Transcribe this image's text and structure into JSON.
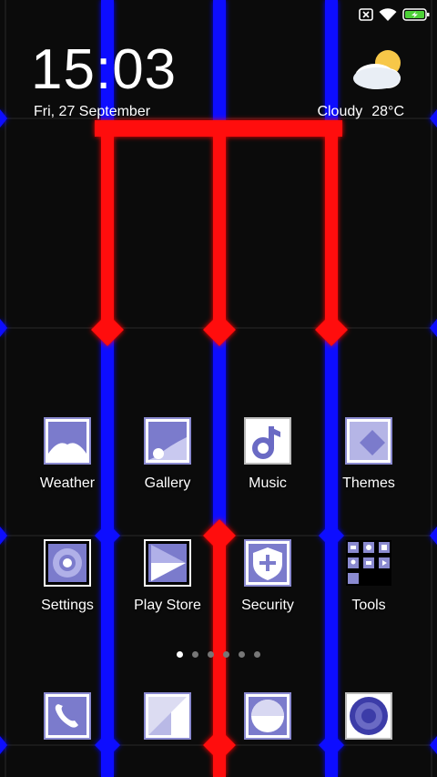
{
  "status_bar": {
    "icons": [
      "sim-off-icon",
      "wifi-icon",
      "battery-charging-icon"
    ],
    "battery_color": "#4cd137"
  },
  "clock": {
    "time": "15:03",
    "date": "Fri, 27 September"
  },
  "weather": {
    "condition": "Cloudy",
    "temperature": "28°C",
    "icon": "cloud-sun-icon"
  },
  "apps": [
    {
      "label": "Weather",
      "icon": "weather-app-icon"
    },
    {
      "label": "Gallery",
      "icon": "gallery-app-icon"
    },
    {
      "label": "Music",
      "icon": "music-note-icon"
    },
    {
      "label": "Themes",
      "icon": "themes-app-icon"
    },
    {
      "label": "Settings",
      "icon": "settings-gear-icon"
    },
    {
      "label": "Play Store",
      "icon": "play-store-icon"
    },
    {
      "label": "Security",
      "icon": "security-shield-icon"
    },
    {
      "label": "Tools",
      "icon": "tools-folder-icon"
    }
  ],
  "page_indicator": {
    "pages": 6,
    "current": 1
  },
  "dock": [
    {
      "icon": "phone-icon"
    },
    {
      "icon": "messages-app-icon"
    },
    {
      "icon": "browser-app-icon"
    },
    {
      "icon": "camera-app-icon"
    }
  ],
  "colors": {
    "wall_red": "#ff0000",
    "wall_blue": "#0000ff",
    "icon_tint": "#7b7bcc",
    "background": "#0b0b0b"
  }
}
